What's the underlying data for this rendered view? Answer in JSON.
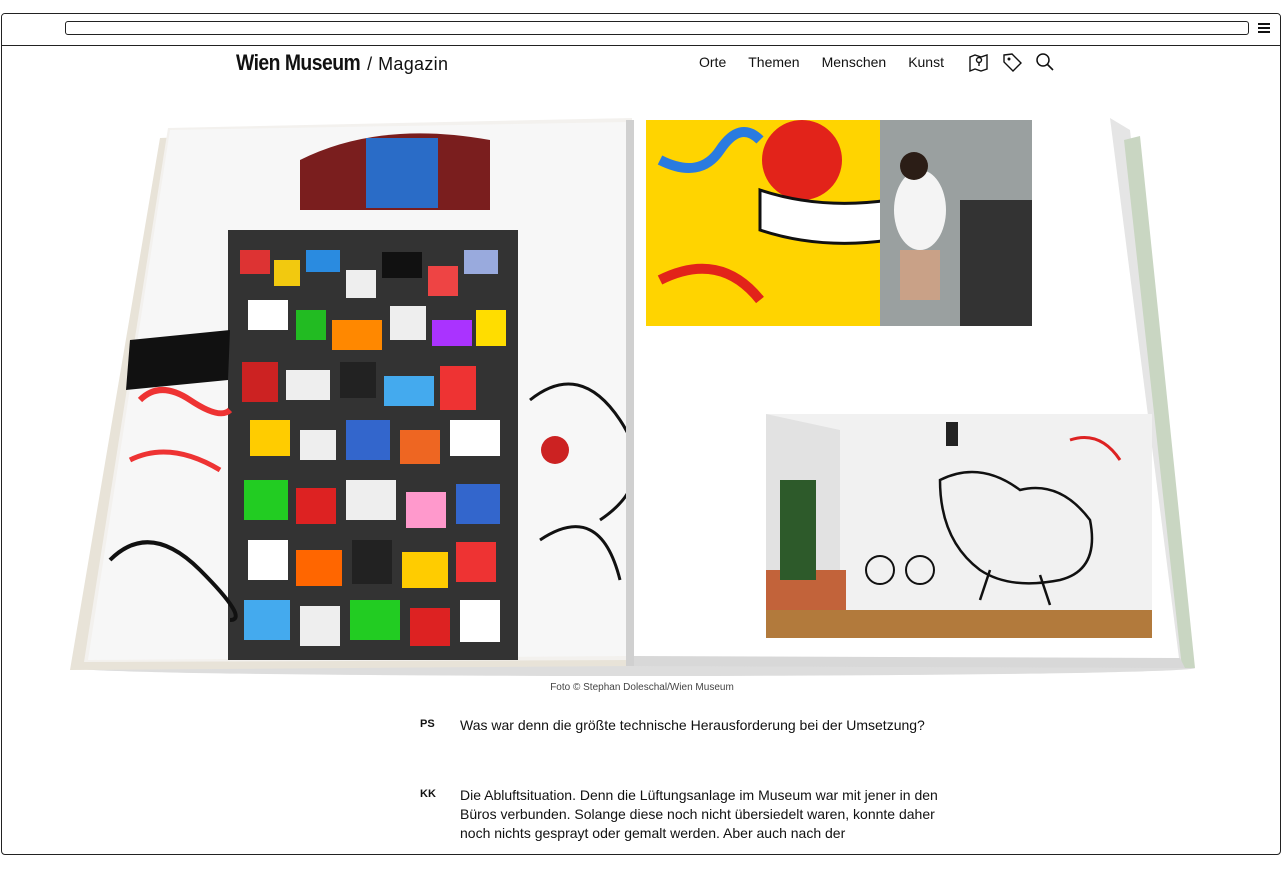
{
  "browser": {
    "url": ""
  },
  "header": {
    "brand_name": "Wien Museum",
    "brand_separator": "/",
    "brand_sub": "Magazin",
    "nav": [
      "Orte",
      "Themen",
      "Menschen",
      "Kunst"
    ],
    "icons": [
      "map-pin-icon",
      "tag-icon",
      "search-icon"
    ]
  },
  "figure": {
    "caption": "Foto © Stephan Doleschal/Wien Museum"
  },
  "interview": [
    {
      "speaker": "PS",
      "text": "Was war denn die größte technische Herausforderung bei der Umsetzung?"
    },
    {
      "speaker": "KK",
      "text": "Die Abluftsituation. Denn die Lüftungsanlage im Museum war mit jener in den Büros verbunden. Solange diese noch nicht übersiedelt waren, konnte daher noch nichts gesprayt oder gemalt werden. Aber auch nach der"
    }
  ],
  "colors": {
    "text": "#111111",
    "border": "#222222",
    "background": "#ffffff"
  }
}
